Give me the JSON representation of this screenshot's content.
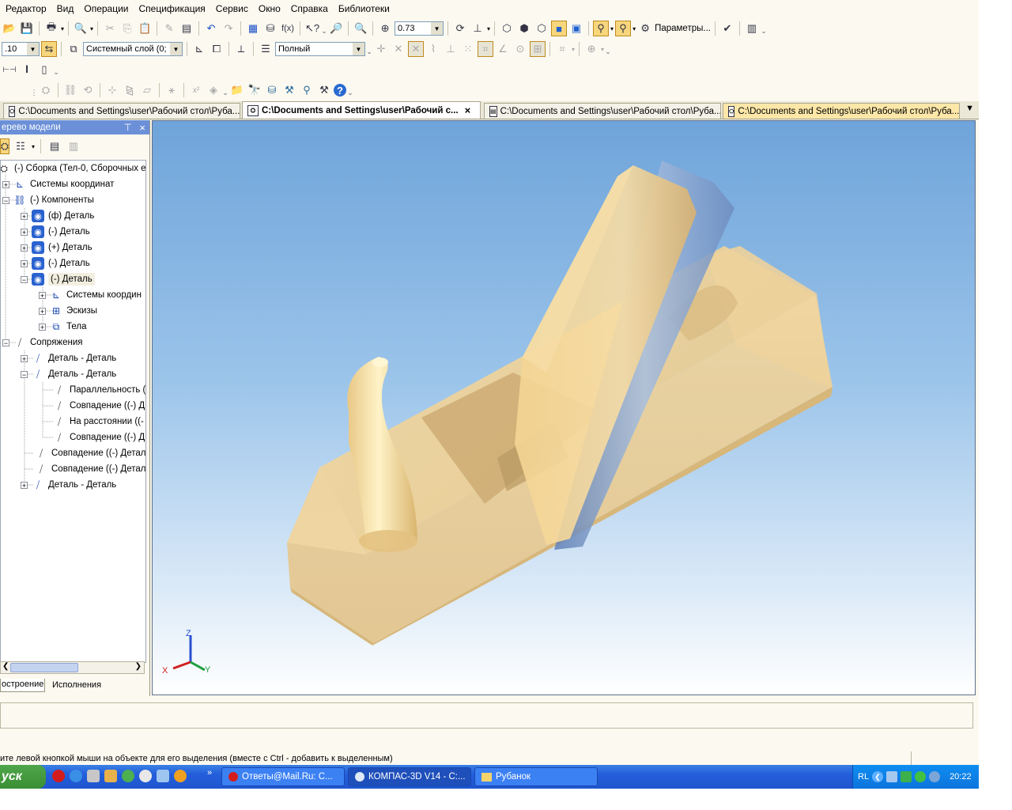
{
  "menu": [
    "Редактор",
    "Вид",
    "Операции",
    "Спецификация",
    "Сервис",
    "Окно",
    "Справка",
    "Библиотеки"
  ],
  "toolbar": {
    "zoom_value": "0.73",
    "params_label": "Параметры...",
    "layer_value": "Системный слой (0;",
    "line_scale": ".10",
    "style_value": "Полный"
  },
  "doc_tabs": [
    {
      "label": "C:\\Documents and Settings\\user\\Рабочий стол\\Руба..."
    },
    {
      "label": "C:\\Documents and Settings\\user\\Рабочий с..."
    },
    {
      "label": "C:\\Documents and Settings\\user\\Рабочий стол\\Руба..."
    },
    {
      "label": "C:\\Documents and Settings\\user\\Рабочий стол\\Руба..."
    }
  ],
  "model_tree": {
    "title": "ерево модели",
    "items": [
      {
        "label": "(-) Сборка (Тел-0, Сборочных е",
        "icon": "assembly-icon"
      },
      {
        "label": "Системы координат",
        "icon": "coordinate-system-icon"
      },
      {
        "label": "(-) Компоненты",
        "icon": "components-icon"
      },
      {
        "label": "(ф) Деталь",
        "icon": "part-icon"
      },
      {
        "label": "(-) Деталь",
        "icon": "part-icon"
      },
      {
        "label": "(+) Деталь",
        "icon": "part-icon"
      },
      {
        "label": "(-) Деталь",
        "icon": "part-icon"
      },
      {
        "label": "(-) Деталь",
        "icon": "part-icon"
      },
      {
        "label": "Системы координ",
        "icon": "coordinate-system-icon"
      },
      {
        "label": "Эскизы",
        "icon": "sketch-icon"
      },
      {
        "label": "Тела",
        "icon": "bodies-icon"
      },
      {
        "label": "Сопряжения",
        "icon": "mate-icon"
      },
      {
        "label": "Деталь - Деталь",
        "icon": "mate-group-icon"
      },
      {
        "label": "Деталь - Деталь",
        "icon": "mate-group-icon"
      },
      {
        "label": "Параллельность (",
        "icon": "mate-icon"
      },
      {
        "label": "Совпадение ((-) Д",
        "icon": "mate-icon"
      },
      {
        "label": "На расстоянии ((-",
        "icon": "mate-icon"
      },
      {
        "label": "Совпадение ((-) Д",
        "icon": "mate-icon"
      },
      {
        "label": "Совпадение ((-) Детал",
        "icon": "mate-icon"
      },
      {
        "label": "Совпадение ((-) Детал",
        "icon": "mate-icon"
      },
      {
        "label": "Деталь - Деталь",
        "icon": "mate-group-icon"
      }
    ],
    "bottom_tabs": [
      "остроение",
      "Исполнения"
    ]
  },
  "viewport": {
    "axis_x": "X",
    "axis_y": "Y",
    "axis_z": "Z"
  },
  "status_text": "ите левой кнопкой мыши на объекте для его выделения (вместе с Ctrl - добавить к выделенным)",
  "taskbar": {
    "start": "уск",
    "tasks": [
      "Ответы@Mail.Ru: С...",
      "КОМПАС-3D V14 - C:...",
      "Рубанок"
    ],
    "lang": "RL",
    "clock": "20:22"
  },
  "colors": {
    "part": "#f0cf8e",
    "blade": "#7fa2cc",
    "viewport_top": "#6fa4da",
    "taskbar": "#245edb"
  }
}
